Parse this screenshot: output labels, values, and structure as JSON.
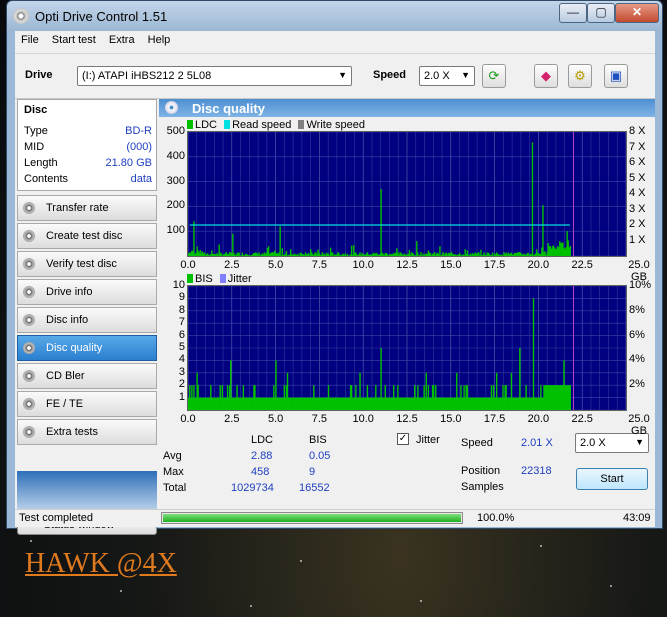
{
  "window": {
    "title": "Opti Drive Control 1.51",
    "minimize": "—",
    "maximize": "▢",
    "close": "✕"
  },
  "menu": [
    "File",
    "Start test",
    "Extra",
    "Help"
  ],
  "toolbar": {
    "drive_label": "Drive",
    "drive_value": "(I:)  ATAPI iHBS212   2 5L08",
    "speed_label": "Speed",
    "speed_value": "2.0 X",
    "icons": [
      "refresh-icon",
      "eraser-icon",
      "settings-icon",
      "save-icon"
    ]
  },
  "disc": {
    "heading": "Disc",
    "rows": [
      {
        "k": "Type",
        "v": "BD-R"
      },
      {
        "k": "MID",
        "v": "(000)"
      },
      {
        "k": "Length",
        "v": "21.80 GB"
      },
      {
        "k": "Contents",
        "v": "data"
      }
    ]
  },
  "nav": [
    "Transfer rate",
    "Create test disc",
    "Verify test disc",
    "Drive info",
    "Disc info",
    "Disc quality",
    "CD Bler",
    "FE / TE",
    "Extra tests"
  ],
  "nav_active": 5,
  "status_window_button": "Status window >>",
  "panel": {
    "title": "Disc quality"
  },
  "chart_data": [
    {
      "type": "bar",
      "legend": [
        "LDC",
        "Read speed",
        "Write speed"
      ],
      "colors": {
        "ldc": "#00c000",
        "read": "#00e0e0",
        "write": "#808080",
        "bg": "#000080"
      },
      "x_ticks": [
        "0.0",
        "2.5",
        "5.0",
        "7.5",
        "10.0",
        "12.5",
        "15.0",
        "17.5",
        "20.0",
        "22.5",
        "25.0 GB"
      ],
      "xlim": [
        0,
        25
      ],
      "y_ticks": [
        "500",
        "400",
        "300",
        "200",
        "100"
      ],
      "ylim": [
        0,
        500
      ],
      "y2_ticks": [
        "8 X",
        "7 X",
        "6 X",
        "5 X",
        "4 X",
        "3 X",
        "2 X",
        "1 X"
      ],
      "y2lim": [
        0,
        8
      ],
      "read_speed_x": 2.0,
      "data_end_gb": 21.8,
      "peaks": [
        {
          "x": 0.3,
          "y": 140
        },
        {
          "x": 2.5,
          "y": 90
        },
        {
          "x": 5.2,
          "y": 120
        },
        {
          "x": 11.0,
          "y": 270
        },
        {
          "x": 13.0,
          "y": 60
        },
        {
          "x": 19.6,
          "y": 458
        },
        {
          "x": 20.2,
          "y": 205
        },
        {
          "x": 21.6,
          "y": 100
        }
      ]
    },
    {
      "type": "bar",
      "legend": [
        "BIS",
        "Jitter"
      ],
      "colors": {
        "bis": "#00c000",
        "jitter": "#8080ff",
        "bg": "#000080"
      },
      "x_ticks": [
        "0.0",
        "2.5",
        "5.0",
        "7.5",
        "10.0",
        "12.5",
        "15.0",
        "17.5",
        "20.0",
        "22.5",
        "25.0 GB"
      ],
      "xlim": [
        0,
        25
      ],
      "y_ticks": [
        "10",
        "9",
        "8",
        "7",
        "6",
        "5",
        "4",
        "3",
        "2",
        "1"
      ],
      "ylim": [
        0,
        10
      ],
      "y2_ticks": [
        "10%",
        "8%",
        "6%",
        "4%",
        "2%"
      ],
      "y2lim": [
        0,
        10
      ],
      "data_end_gb": 21.8,
      "peaks": [
        {
          "x": 0.5,
          "y": 3
        },
        {
          "x": 2.4,
          "y": 4
        },
        {
          "x": 5.0,
          "y": 4
        },
        {
          "x": 11.0,
          "y": 5
        },
        {
          "x": 18.9,
          "y": 5
        },
        {
          "x": 19.7,
          "y": 9
        },
        {
          "x": 21.4,
          "y": 4
        }
      ]
    }
  ],
  "stats": {
    "col_ldc": "LDC",
    "col_bis": "BIS",
    "avg_label": "Avg",
    "avg_ldc": "2.88",
    "avg_bis": "0.05",
    "max_label": "Max",
    "max_ldc": "458",
    "max_bis": "9",
    "total_label": "Total",
    "total_ldc": "1029734",
    "total_bis": "16552",
    "jitter_label": "Jitter",
    "jitter_checked": true,
    "speed_label": "Speed",
    "speed_value": "2.01 X",
    "speed_combo": "2.0 X",
    "position_label": "Position",
    "position_value": "22318",
    "samples_label": "Samples",
    "start_button": "Start"
  },
  "status": {
    "text": "Test completed",
    "progress_fraction": 1.0,
    "percent": "100.0%",
    "time": "43:09"
  },
  "overlay_text": "HAWK  @4X"
}
